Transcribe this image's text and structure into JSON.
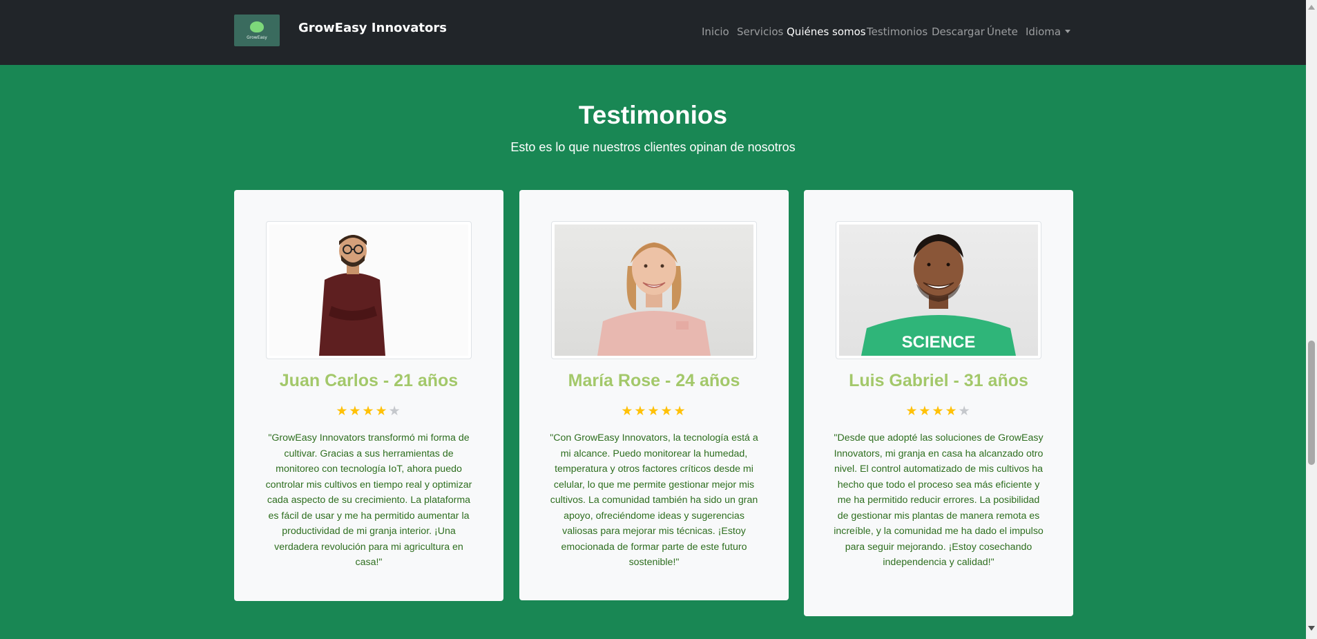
{
  "navbar": {
    "logo_text": "GrowEasy",
    "brand_name": "GrowEasy Innovators",
    "links": [
      {
        "label": "Inicio",
        "active": false
      },
      {
        "label": "Servicios",
        "active": false
      },
      {
        "label": "Quiénes somos",
        "active": true
      },
      {
        "label": "Testimonios",
        "active": false
      },
      {
        "label": "Descargar",
        "active": false
      },
      {
        "label": "Únete",
        "active": false
      },
      {
        "label": "Idioma",
        "active": false,
        "dropdown": true
      }
    ]
  },
  "section": {
    "title": "Testimonios",
    "subtitle": "Esto es lo que nuestros clientes opinan de nosotros"
  },
  "testimonials": [
    {
      "name": "Juan Carlos - 21 años",
      "rating": 4,
      "max_rating": 5,
      "quote": "\"GrowEasy Innovators transformó mi forma de cultivar. Gracias a sus herramientas de monitoreo con tecnología IoT, ahora puedo controlar mis cultivos en tiempo real y optimizar cada aspecto de su crecimiento. La plataforma es fácil de usar y me ha permitido aumentar la productividad de mi granja interior. ¡Una verdadera revolución para mi agricultura en casa!\""
    },
    {
      "name": "María Rose - 24 años",
      "rating": 5,
      "max_rating": 5,
      "quote": "\"Con GrowEasy Innovators, la tecnología está a mi alcance. Puedo monitorear la humedad, temperatura y otros factores críticos desde mi celular, lo que me permite gestionar mejor mis cultivos. La comunidad también ha sido un gran apoyo, ofreciéndome ideas y sugerencias valiosas para mejorar mis técnicas. ¡Estoy emocionada de formar parte de este futuro sostenible!\""
    },
    {
      "name": "Luis Gabriel - 31 años",
      "rating": 4,
      "max_rating": 5,
      "quote": "\"Desde que adopté las soluciones de GrowEasy Innovators, mi granja en casa ha alcanzado otro nivel. El control automatizado de mis cultivos ha hecho que todo el proceso sea más eficiente y me ha permitido reducir errores. La posibilidad de gestionar mis plantas de manera remota es increíble, y la comunidad me ha dado el impulso para seguir mejorando. ¡Estoy cosechando independencia y calidad!\"",
      "shirt_text": "SCIENCE"
    }
  ],
  "colors": {
    "navbar_bg": "#212529",
    "section_bg": "#198754",
    "card_bg": "#f8f9fa",
    "name_color": "#a3c86a",
    "quote_color": "#2e6e1f",
    "star_filled": "#ffc107",
    "star_empty": "#c5c8cc"
  },
  "icons": {
    "star": "star-icon",
    "dropdown": "caret-down-icon",
    "scroll_up": "scroll-up-arrow-icon",
    "scroll_down": "scroll-down-arrow-icon"
  }
}
